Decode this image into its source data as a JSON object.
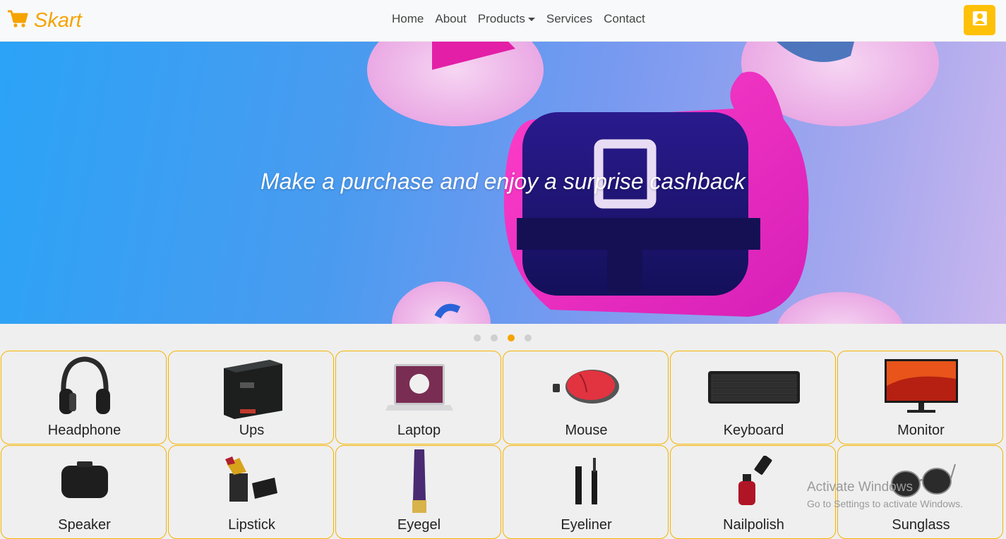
{
  "brand": {
    "name": "Skart",
    "icon": "cart-icon"
  },
  "nav": {
    "home": "Home",
    "about": "About",
    "products": "Products",
    "services": "Services",
    "contact": "Contact"
  },
  "user_button": {
    "icon": "user-icon"
  },
  "hero": {
    "caption": "Make a purchase and enjoy a surprise cashback"
  },
  "carousel": {
    "slides": 4,
    "active_index": 2
  },
  "categories": [
    {
      "label": "Headphone",
      "icon": "headphone-icon"
    },
    {
      "label": "Ups",
      "icon": "ups-icon"
    },
    {
      "label": "Laptop",
      "icon": "laptop-icon"
    },
    {
      "label": "Mouse",
      "icon": "mouse-icon"
    },
    {
      "label": "Keyboard",
      "icon": "keyboard-icon"
    },
    {
      "label": "Monitor",
      "icon": "monitor-icon"
    },
    {
      "label": "Speaker",
      "icon": "speaker-icon"
    },
    {
      "label": "Lipstick",
      "icon": "lipstick-icon"
    },
    {
      "label": "Eyegel",
      "icon": "eyegel-icon"
    },
    {
      "label": "Eyeliner",
      "icon": "eyeliner-icon"
    },
    {
      "label": "Nailpolish",
      "icon": "nailpolish-icon"
    },
    {
      "label": "Sunglass",
      "icon": "sunglass-icon"
    }
  ],
  "watermark": {
    "line1": "Activate Windows",
    "line2": "Go to Settings to activate Windows."
  },
  "colors": {
    "accent": "#f5a300",
    "button": "#ffc107",
    "navbar": "#f8f9fa",
    "card_border": "#f5b400"
  }
}
